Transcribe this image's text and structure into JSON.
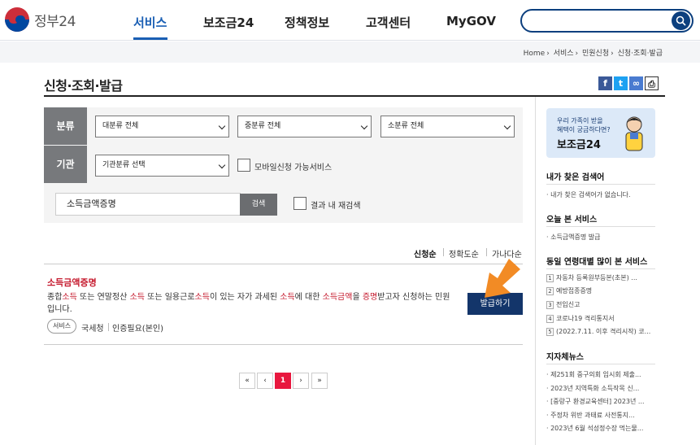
{
  "header": {
    "logo_text": "정부24",
    "nav": [
      {
        "label": "서비스",
        "active": true
      },
      {
        "label": "보조금24",
        "active": false
      },
      {
        "label": "정책정보",
        "active": false
      },
      {
        "label": "고객센터",
        "active": false
      },
      {
        "label": "MyGOV",
        "active": false
      }
    ],
    "search_value": ""
  },
  "breadcrumb": [
    "Home",
    "서비스",
    "민원신청",
    "신청·조회·발급"
  ],
  "page_title": "신청·조회·발급",
  "share_icons": [
    "facebook-icon",
    "twitter-icon",
    "link-icon",
    "print-icon"
  ],
  "filter": {
    "category_label": "분류",
    "agency_label": "기관",
    "category_large": "대분류 전체",
    "category_mid": "중분류 전체",
    "category_small": "소분류 전체",
    "agency_select": "기관분류 선택",
    "mobile_checkbox": "모바일신청 가능서비스",
    "keyword": "소득금액증명",
    "search_button": "검색",
    "research_checkbox": "결과 내 재검색"
  },
  "sort": [
    "신청순",
    "정확도순",
    "가나다순"
  ],
  "result": {
    "title": "소득금액증명",
    "desc_segments": [
      {
        "t": "종합",
        "hl": false
      },
      {
        "t": "소득",
        "hl": true
      },
      {
        "t": " 또는 연말정산 ",
        "hl": false
      },
      {
        "t": "소득",
        "hl": true
      },
      {
        "t": " 또는 일용근로",
        "hl": false
      },
      {
        "t": "소득",
        "hl": true
      },
      {
        "t": "이 있는 자가 과세된 ",
        "hl": false
      },
      {
        "t": "소득",
        "hl": true
      },
      {
        "t": "에 대한 ",
        "hl": false
      },
      {
        "t": "소득금액",
        "hl": true
      },
      {
        "t": "을 ",
        "hl": false
      },
      {
        "t": "증명",
        "hl": true
      },
      {
        "t": "받고자 신청하는 민원입니다.",
        "hl": false
      }
    ],
    "tag": "서비스",
    "agency": "국세청",
    "auth": "인증필요(본인)",
    "issue_button": "발급하기"
  },
  "pagination": [
    "«",
    "‹",
    "1",
    "›",
    "»"
  ],
  "sidebar": {
    "banner_question": "우리 가족이 받을\n혜택이 궁금하다면?",
    "banner_name": "보조금24",
    "recent_search_title": "내가 찾은 검색어",
    "recent_search_empty": "· 내가 찾은 검색어가 없습니다.",
    "today_title": "오늘 본 서비스",
    "today_items": [
      "· 소득금액증명 발급"
    ],
    "popular_title": "동일 연령대별 많이 본 서비스",
    "popular_items": [
      "자동차 등록원부등본(초본) ...",
      "예방접종증명",
      "전입신고",
      "코로나19 격리통지서",
      "(2022.7.11. 이후 격리시작) 코..."
    ],
    "local_title": "지자체뉴스",
    "local_items": [
      "· 제251회 중구의회 임시회 제출...",
      "· 2023년 지역특화 소득작목 신...",
      "· [중랑구 환경교육센터] 2023년 ...",
      "· 주정차 위반 과태료 사전통지...",
      "· 2023년 6월 석성정수장 먹는물..."
    ]
  }
}
